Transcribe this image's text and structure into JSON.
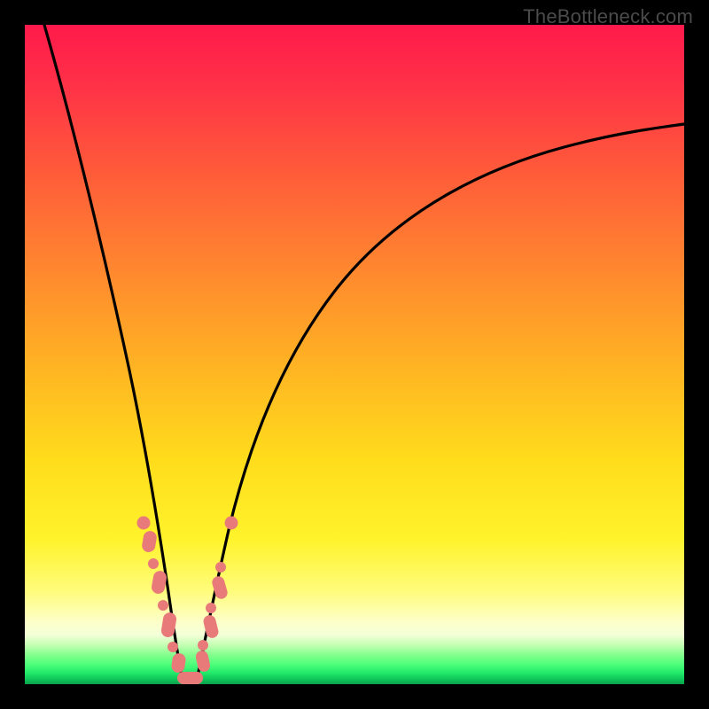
{
  "watermark": "TheBottleneck.com",
  "colors": {
    "frame": "#000000",
    "curve": "#000000",
    "marker": "#e97a7a",
    "gradient_top": "#ff1a4b",
    "gradient_bottom": "#0aa24a"
  },
  "chart_data": {
    "type": "line",
    "title": "",
    "xlabel": "",
    "ylabel": "",
    "xlim": [
      0,
      100
    ],
    "ylim": [
      0,
      100
    ],
    "note": "No axis ticks or numeric labels are shown in the image; values below are pixel-proportional estimates on a 0–100 scale in each axis.",
    "series": [
      {
        "name": "left-branch",
        "x": [
          3,
          6,
          9,
          12,
          14,
          16,
          18,
          19,
          20,
          21,
          22,
          23
        ],
        "y": [
          100,
          80,
          62,
          46,
          36,
          28,
          20,
          14,
          9,
          5,
          2,
          0
        ]
      },
      {
        "name": "right-branch",
        "x": [
          24,
          25,
          26,
          27,
          28,
          30,
          34,
          40,
          48,
          58,
          70,
          84,
          100
        ],
        "y": [
          0,
          3,
          7,
          12,
          17,
          25,
          37,
          49,
          59,
          67,
          74,
          79,
          83
        ]
      }
    ],
    "markers": {
      "name": "highlighted-points",
      "comment": "Salmon dots/pills clustered near the valley minimum on both branches.",
      "points": [
        {
          "x": 17.5,
          "y": 24
        },
        {
          "x": 18.5,
          "y": 18
        },
        {
          "x": 19.5,
          "y": 12
        },
        {
          "x": 20.2,
          "y": 8
        },
        {
          "x": 21.0,
          "y": 5
        },
        {
          "x": 21.8,
          "y": 2.5
        },
        {
          "x": 22.6,
          "y": 1
        },
        {
          "x": 23.4,
          "y": 0.3
        },
        {
          "x": 24.2,
          "y": 0.4
        },
        {
          "x": 25.0,
          "y": 1.5
        },
        {
          "x": 25.8,
          "y": 4
        },
        {
          "x": 26.6,
          "y": 7.5
        },
        {
          "x": 27.5,
          "y": 12
        },
        {
          "x": 28.4,
          "y": 17
        },
        {
          "x": 29.6,
          "y": 23
        }
      ]
    }
  }
}
